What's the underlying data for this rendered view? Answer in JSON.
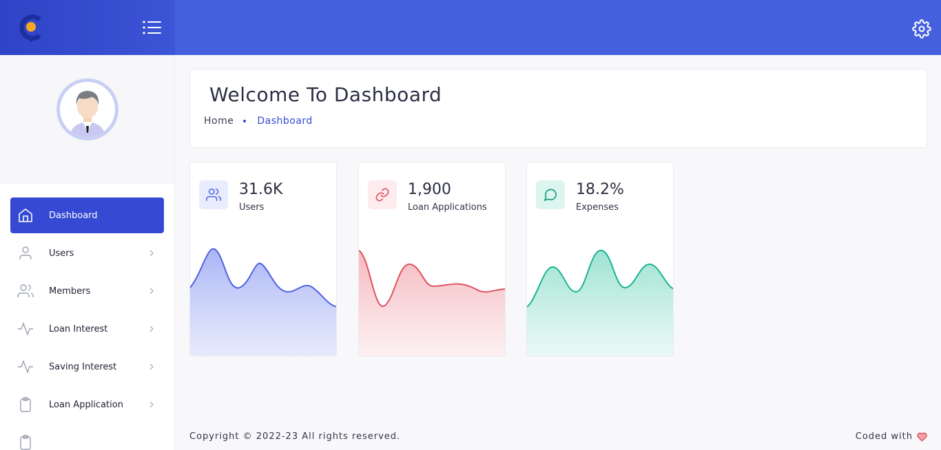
{
  "header": {
    "logo_icon": "app-logo",
    "menu_icon": "menu-list-icon",
    "settings_icon": "gear-icon",
    "accent": "#4560dd"
  },
  "sidebar": {
    "avatar_icon": "user-avatar",
    "items": [
      {
        "label": "Dashboard",
        "icon": "home-icon",
        "active": true
      },
      {
        "label": "Users",
        "icon": "user-icon"
      },
      {
        "label": "Members",
        "icon": "users-icon"
      },
      {
        "label": "Loan Interest",
        "icon": "activity-icon"
      },
      {
        "label": "Saving Interest",
        "icon": "activity-icon"
      },
      {
        "label": "Loan Application",
        "icon": "clipboard-icon"
      }
    ]
  },
  "page": {
    "title": "Welcome To Dashboard",
    "breadcrumb": {
      "home": "Home",
      "current": "Dashboard"
    }
  },
  "cards": [
    {
      "value": "31.6K",
      "label": "Users",
      "icon": "users-icon",
      "color": "#4f62e0"
    },
    {
      "value": "1,900",
      "label": "Loan Applications",
      "icon": "link-icon",
      "color": "#e0525f"
    },
    {
      "value": "18.2%",
      "label": "Expenses",
      "icon": "message-icon",
      "color": "#1ab394"
    }
  ],
  "footer": {
    "copyright": "Copyright © 2022-23 All rights reserved.",
    "coded_with": "Coded with",
    "heart_icon": "heart-icon"
  }
}
